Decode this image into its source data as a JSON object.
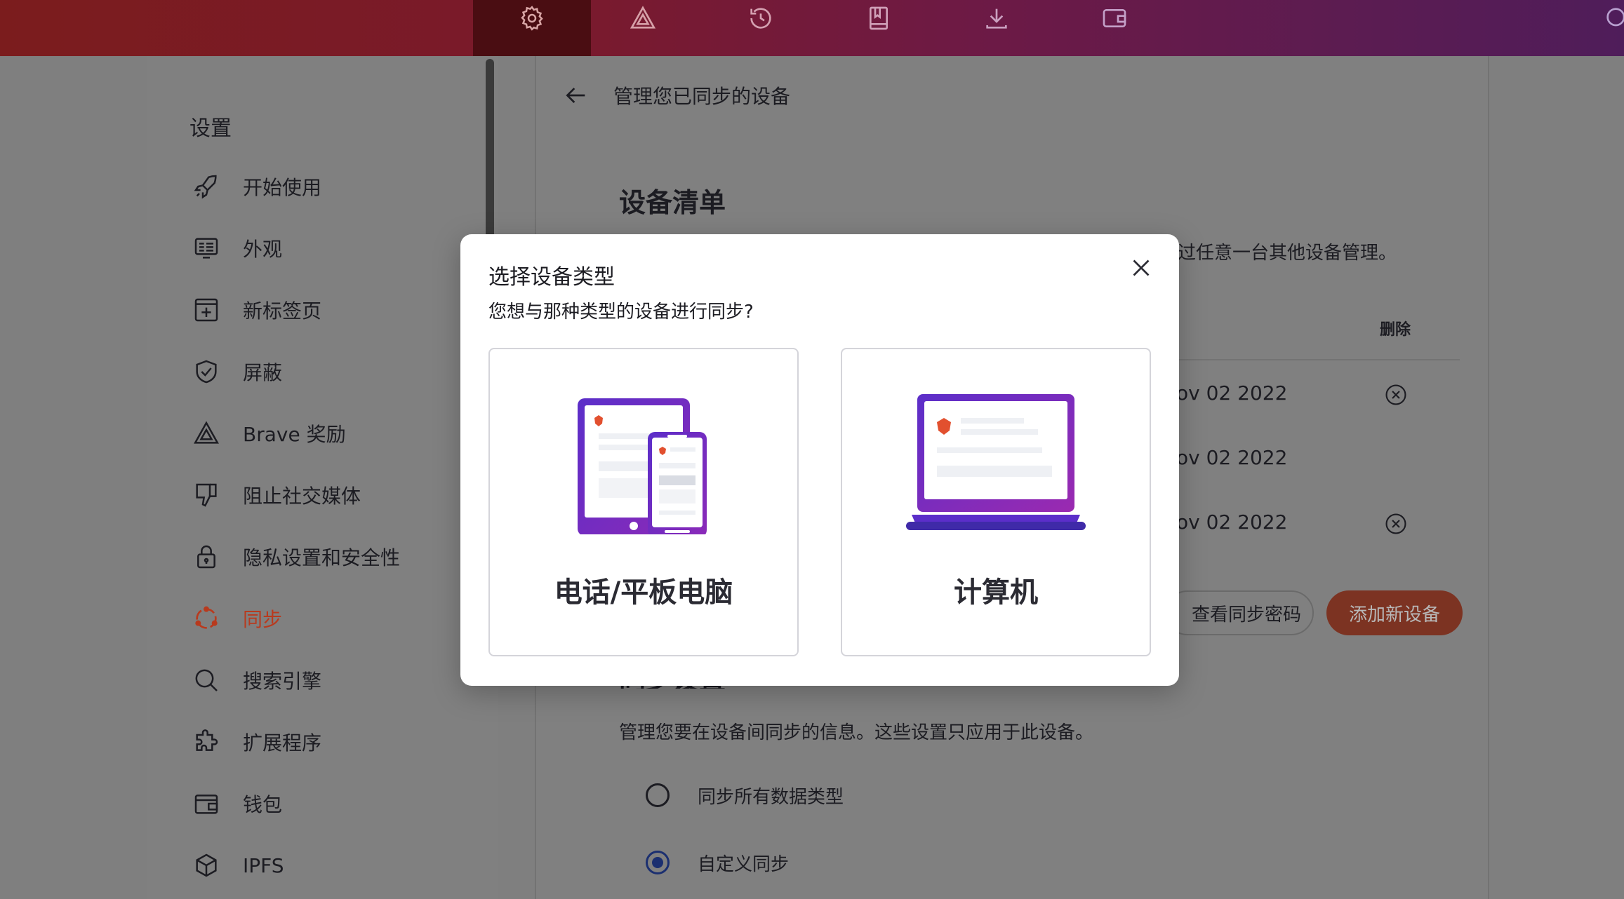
{
  "topbar": {
    "tabs": [
      {
        "icon": "gear-icon",
        "active": true
      },
      {
        "icon": "brave-rewards-triangle-icon",
        "active": false
      },
      {
        "icon": "history-icon",
        "active": false
      },
      {
        "icon": "bookmarks-icon",
        "active": false
      },
      {
        "icon": "download-icon",
        "active": false
      },
      {
        "icon": "wallet-icon",
        "active": false
      }
    ],
    "edge_icon": "search-icon"
  },
  "sidebar": {
    "title": "设置",
    "items": [
      {
        "label": "开始使用",
        "icon": "rocket-icon"
      },
      {
        "label": "外观",
        "icon": "appearance-icon"
      },
      {
        "label": "新标签页",
        "icon": "new-tab-icon"
      },
      {
        "label": "屏蔽",
        "icon": "shield-icon"
      },
      {
        "label": "Brave 奖励",
        "icon": "brave-rewards-triangle-icon"
      },
      {
        "label": "阻止社交媒体",
        "icon": "thumbs-down-icon"
      },
      {
        "label": "隐私设置和安全性",
        "icon": "lock-icon"
      },
      {
        "label": "同步",
        "icon": "sync-icon",
        "active": true
      },
      {
        "label": "搜索引擎",
        "icon": "search-icon"
      },
      {
        "label": "扩展程序",
        "icon": "puzzle-icon"
      },
      {
        "label": "钱包",
        "icon": "wallet-icon"
      },
      {
        "label": "IPFS",
        "icon": "cube-icon"
      }
    ]
  },
  "main": {
    "page_title": "管理您已同步的设备",
    "section_title": "设备清单",
    "description_partial": "过任意一台其他设备管理。",
    "delete_header": "删除",
    "devices": [
      {
        "date_partial": "ov 02 2022",
        "deletable": true
      },
      {
        "date_partial": "ov 02 2022",
        "deletable": false
      },
      {
        "date_partial": "ov 02 2022",
        "deletable": true
      }
    ],
    "view_code_button": "查看同步密码",
    "add_device_button": "添加新设备",
    "sync_settings_heading": "同步设置",
    "sync_settings_description": "管理您要在设备间同步的信息。这些设置只应用于此设备。",
    "radio_options": [
      {
        "label": "同步所有数据类型",
        "checked": false
      },
      {
        "label": "自定义同步",
        "checked": true
      }
    ]
  },
  "modal": {
    "title": "选择设备类型",
    "subtitle": "您想与那种类型的设备进行同步?",
    "choices": [
      {
        "label": "电话/平板电脑",
        "icon": "phone-tablet-illustration"
      },
      {
        "label": "计算机",
        "icon": "laptop-illustration"
      }
    ],
    "close_icon": "close-icon"
  },
  "colors": {
    "accent": "#b83a1e",
    "add_button": "#7c3322",
    "radio_checked": "#1b2f70",
    "illustration_purple": "#5b2ec9",
    "brave_orange": "#e2502f"
  }
}
